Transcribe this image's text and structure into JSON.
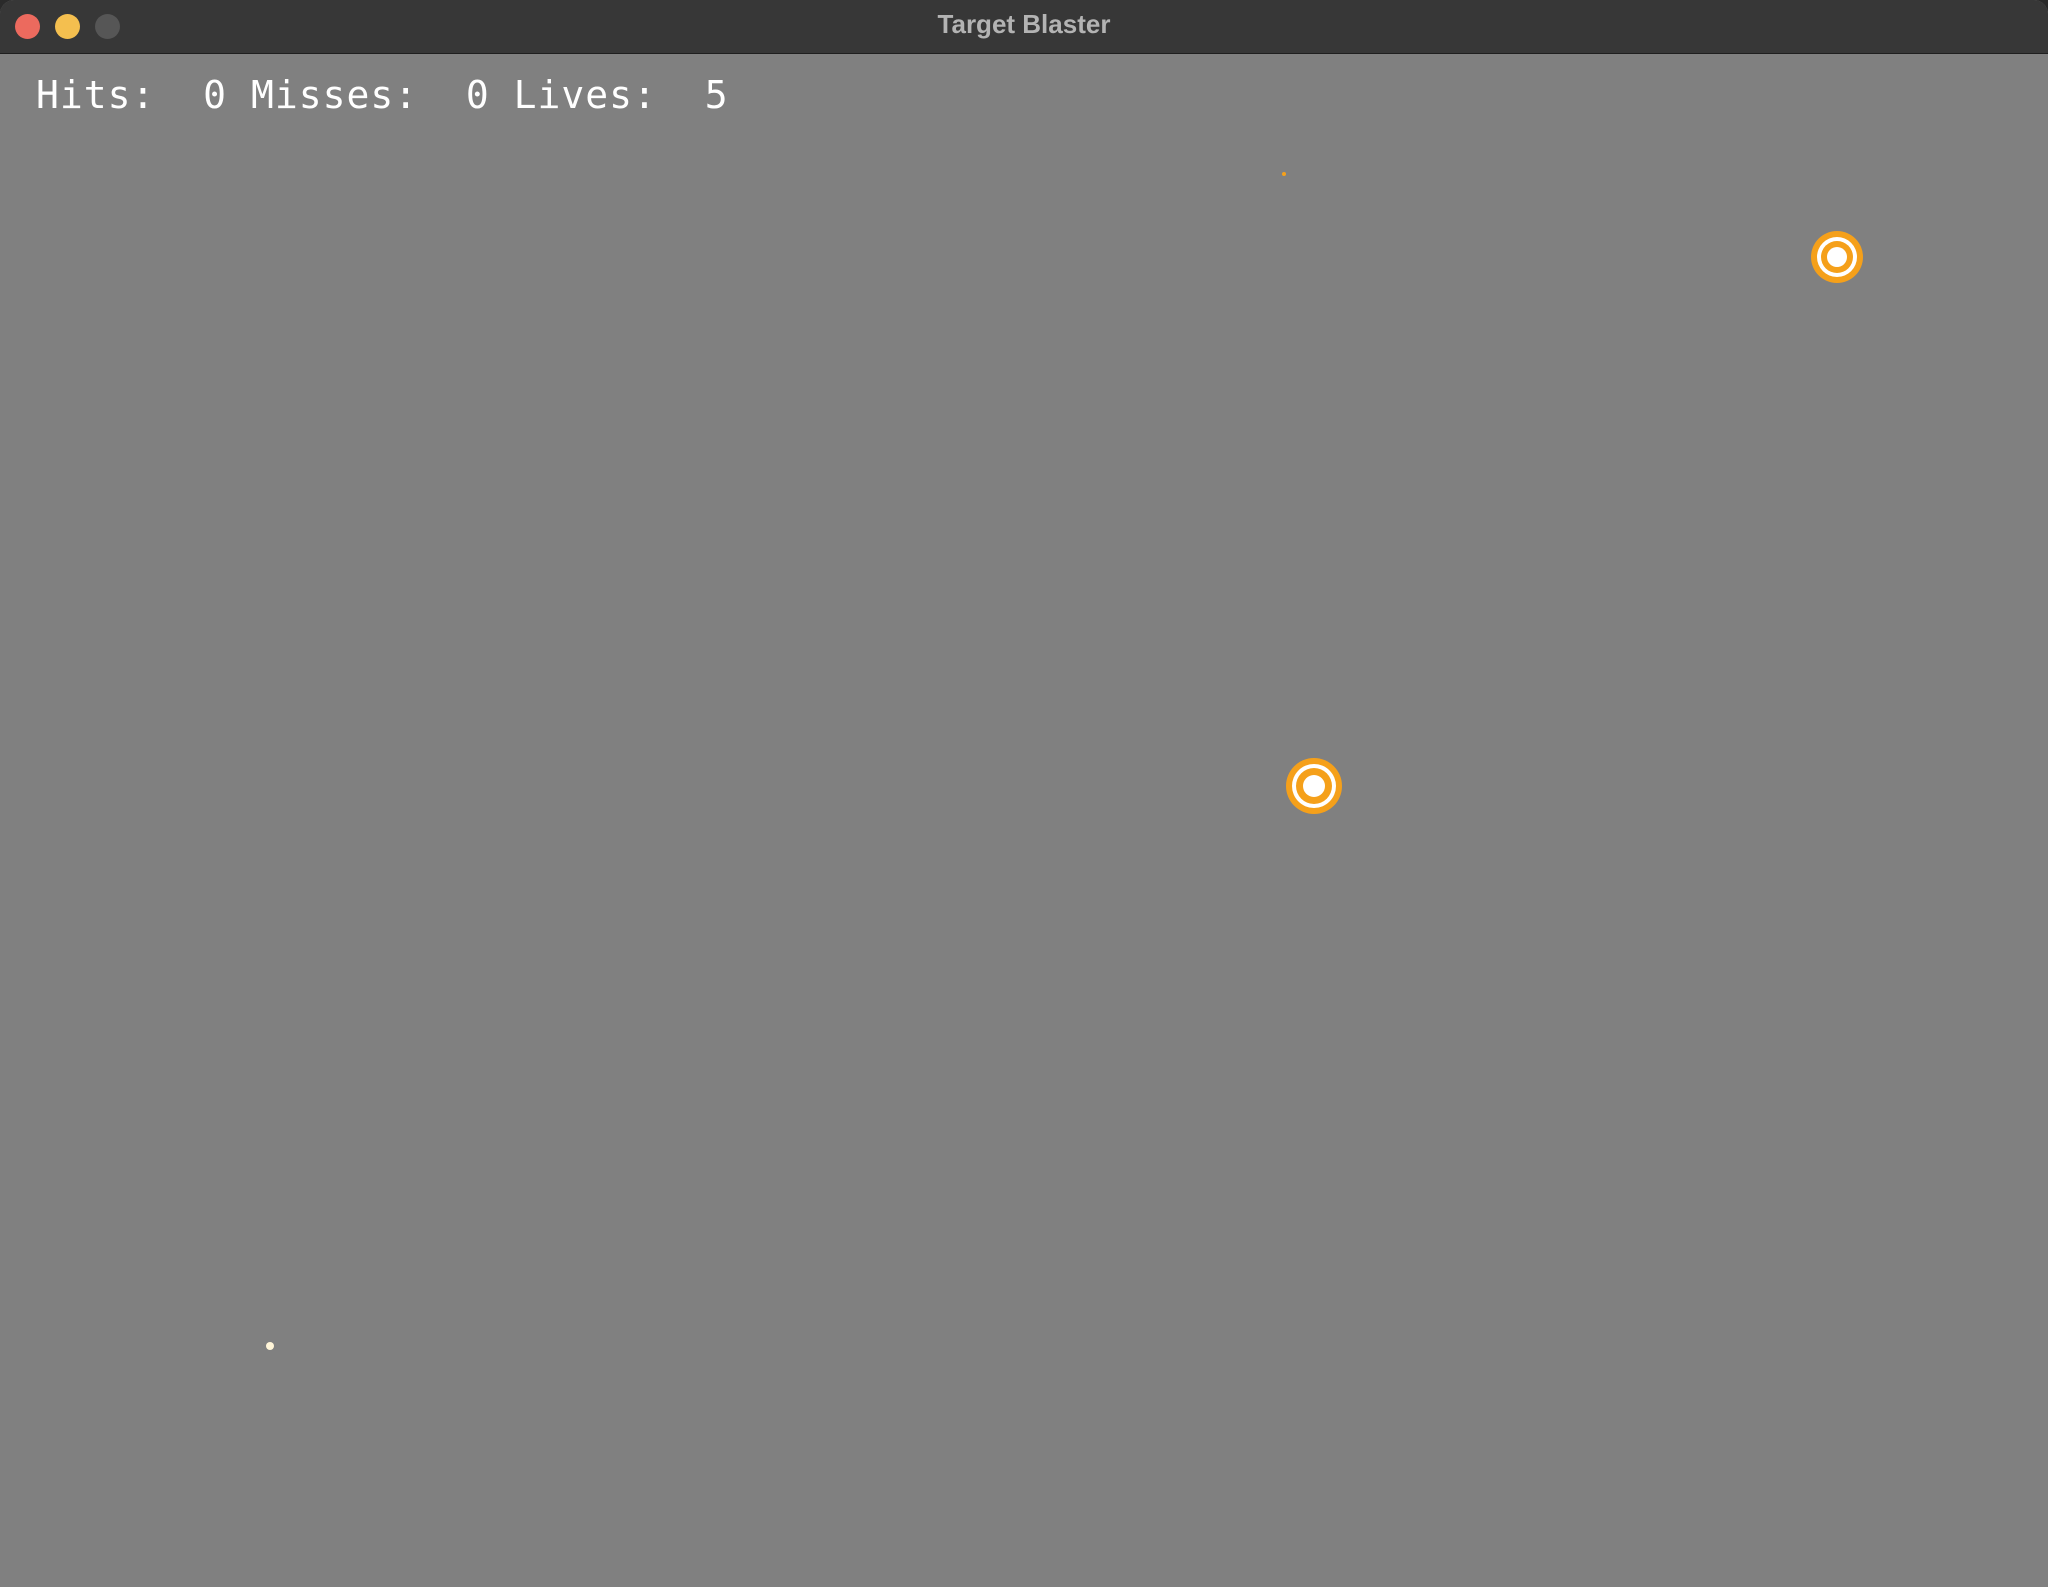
{
  "window": {
    "title": "Target Blaster"
  },
  "hud": {
    "hits_label": "Hits:",
    "hits_value": "0",
    "misses_label": "Misses:",
    "misses_value": "0",
    "lives_label": "Lives:",
    "lives_value": "5"
  },
  "colors": {
    "background": "#808080",
    "target_orange": "#f5a01a",
    "target_white": "#ffffff",
    "hud_text": "#ffffff"
  }
}
